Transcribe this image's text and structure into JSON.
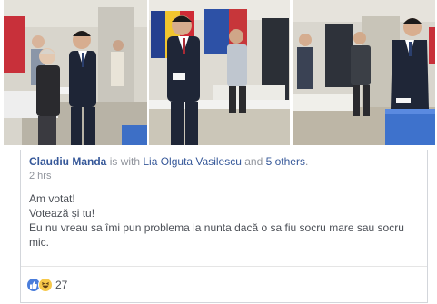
{
  "post": {
    "author": "Claudiu Manda",
    "with_text": "is with",
    "tagged_person": "Lia Olguta Vasilescu",
    "and_text": "and",
    "others": "5 others",
    "period": ".",
    "time": "2 hrs",
    "lines": [
      "Am votat!",
      "Votează și tu!",
      "Eu nu vreau sa îmi pun problema la nunta dacă o sa fiu socru mare sau socru mic."
    ]
  },
  "reactions": {
    "count": "27",
    "icons": [
      "like-icon",
      "haha-icon"
    ],
    "colors": {
      "like": "#4a7ddb",
      "haha": "#f6c84a"
    }
  },
  "photos": [
    {
      "name": "photo-voting-1"
    },
    {
      "name": "photo-voting-2"
    },
    {
      "name": "photo-voting-3"
    }
  ],
  "colors": {
    "link": "#365899",
    "meta": "#90949c",
    "text": "#4b4f56",
    "border": "#d3d6db"
  }
}
